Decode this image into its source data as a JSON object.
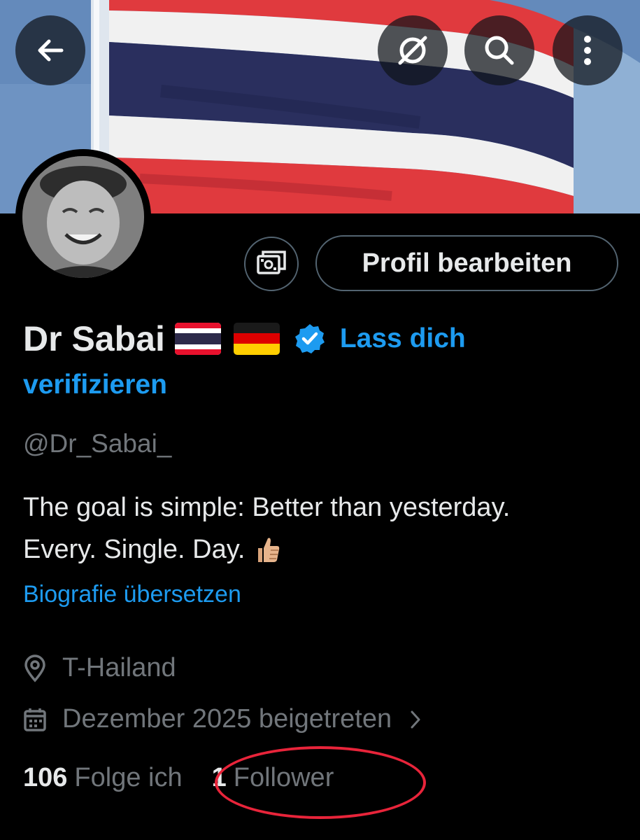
{
  "header": {
    "back_icon": "arrow-left-icon",
    "grok_icon": "slash-circle-icon",
    "search_icon": "search-icon",
    "more_icon": "more-vertical-icon"
  },
  "profile": {
    "display_name": "Dr Sabai",
    "flags": [
      "Thailand flag",
      "Germany flag"
    ],
    "verify_prefix": "Lass dich",
    "verify_suffix": "verifizieren",
    "handle": "@Dr_Sabai_",
    "bio_line1": "The goal is simple:  Better than yesterday.",
    "bio_line2": "Every. Single. Day.",
    "translate_bio": "Biografie übersetzen",
    "location": "T-Hailand",
    "joined": "Dezember 2025 beigetreten",
    "following_count": "106",
    "following_label": "Folge ich",
    "followers_count": "1",
    "followers_label": "Follower"
  },
  "actions": {
    "edit_profile": "Profil bearbeiten",
    "money_icon": "money-icon"
  },
  "colors": {
    "accent": "#1d9bf0",
    "annotation": "#e8243a",
    "muted": "#71767b"
  }
}
